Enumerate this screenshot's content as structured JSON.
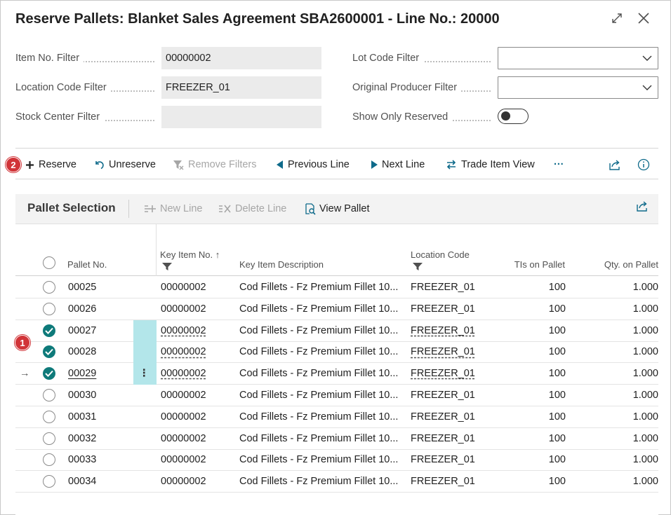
{
  "window": {
    "title": "Reserve Pallets: Blanket Sales Agreement SBA2600001 - Line No.: 20000",
    "expand_icon": "expand-icon",
    "close_icon": "close-icon"
  },
  "filters": {
    "item_no": {
      "label": "Item No. Filter",
      "value": "00000002"
    },
    "location_code": {
      "label": "Location Code Filter",
      "value": "FREEZER_01"
    },
    "stock_center": {
      "label": "Stock Center Filter",
      "value": ""
    },
    "lot_code": {
      "label": "Lot Code Filter",
      "value": ""
    },
    "original_producer": {
      "label": "Original Producer Filter",
      "value": ""
    },
    "show_only_reserved": {
      "label": "Show Only Reserved",
      "value": false
    }
  },
  "actions": {
    "reserve": "Reserve",
    "unreserve": "Unreserve",
    "remove_filters": "Remove Filters",
    "previous_line": "Previous Line",
    "next_line": "Next Line",
    "trade_item_view": "Trade Item View",
    "more": "···"
  },
  "badges": {
    "reserve_badge": "2",
    "rows_badge": "1"
  },
  "colors": {
    "accent": "#0e7a7a",
    "badge": "#d13438",
    "selection": "#b3e6ea"
  },
  "pallet_selection": {
    "title": "Pallet Selection",
    "actions": {
      "new_line": "New Line",
      "delete_line": "Delete Line",
      "view_pallet": "View Pallet"
    },
    "columns": {
      "pallet_no": "Pallet No.",
      "key_item_no": "Key Item No.",
      "sort_indicator": "↑",
      "key_item_description": "Key Item Description",
      "location_code": "Location Code",
      "tis_on_pallet": "TIs on Pallet",
      "qty_on_pallet": "Qty. on Pallet"
    },
    "rows": [
      {
        "selected": false,
        "current": false,
        "pallet_no": "00025",
        "key_item_no": "00000002",
        "description": "Cod Fillets - Fz Premium Fillet 10...",
        "location": "FREEZER_01",
        "tis": "100",
        "qty": "1.000"
      },
      {
        "selected": false,
        "current": false,
        "pallet_no": "00026",
        "key_item_no": "00000002",
        "description": "Cod Fillets - Fz Premium Fillet 10...",
        "location": "FREEZER_01",
        "tis": "100",
        "qty": "1.000"
      },
      {
        "selected": true,
        "current": false,
        "pallet_no": "00027",
        "key_item_no": "00000002",
        "description": "Cod Fillets - Fz Premium Fillet 10...",
        "location": "FREEZER_01",
        "tis": "100",
        "qty": "1.000"
      },
      {
        "selected": true,
        "current": false,
        "pallet_no": "00028",
        "key_item_no": "00000002",
        "description": "Cod Fillets - Fz Premium Fillet 10...",
        "location": "FREEZER_01",
        "tis": "100",
        "qty": "1.000"
      },
      {
        "selected": true,
        "current": true,
        "pallet_no": "00029",
        "key_item_no": "00000002",
        "description": "Cod Fillets - Fz Premium Fillet 10...",
        "location": "FREEZER_01",
        "tis": "100",
        "qty": "1.000"
      },
      {
        "selected": false,
        "current": false,
        "pallet_no": "00030",
        "key_item_no": "00000002",
        "description": "Cod Fillets - Fz Premium Fillet 10...",
        "location": "FREEZER_01",
        "tis": "100",
        "qty": "1.000"
      },
      {
        "selected": false,
        "current": false,
        "pallet_no": "00031",
        "key_item_no": "00000002",
        "description": "Cod Fillets - Fz Premium Fillet 10...",
        "location": "FREEZER_01",
        "tis": "100",
        "qty": "1.000"
      },
      {
        "selected": false,
        "current": false,
        "pallet_no": "00032",
        "key_item_no": "00000002",
        "description": "Cod Fillets - Fz Premium Fillet 10...",
        "location": "FREEZER_01",
        "tis": "100",
        "qty": "1.000"
      },
      {
        "selected": false,
        "current": false,
        "pallet_no": "00033",
        "key_item_no": "00000002",
        "description": "Cod Fillets - Fz Premium Fillet 10...",
        "location": "FREEZER_01",
        "tis": "100",
        "qty": "1.000"
      },
      {
        "selected": false,
        "current": false,
        "pallet_no": "00034",
        "key_item_no": "00000002",
        "description": "Cod Fillets - Fz Premium Fillet 10...",
        "location": "FREEZER_01",
        "tis": "100",
        "qty": "1.000"
      }
    ]
  }
}
